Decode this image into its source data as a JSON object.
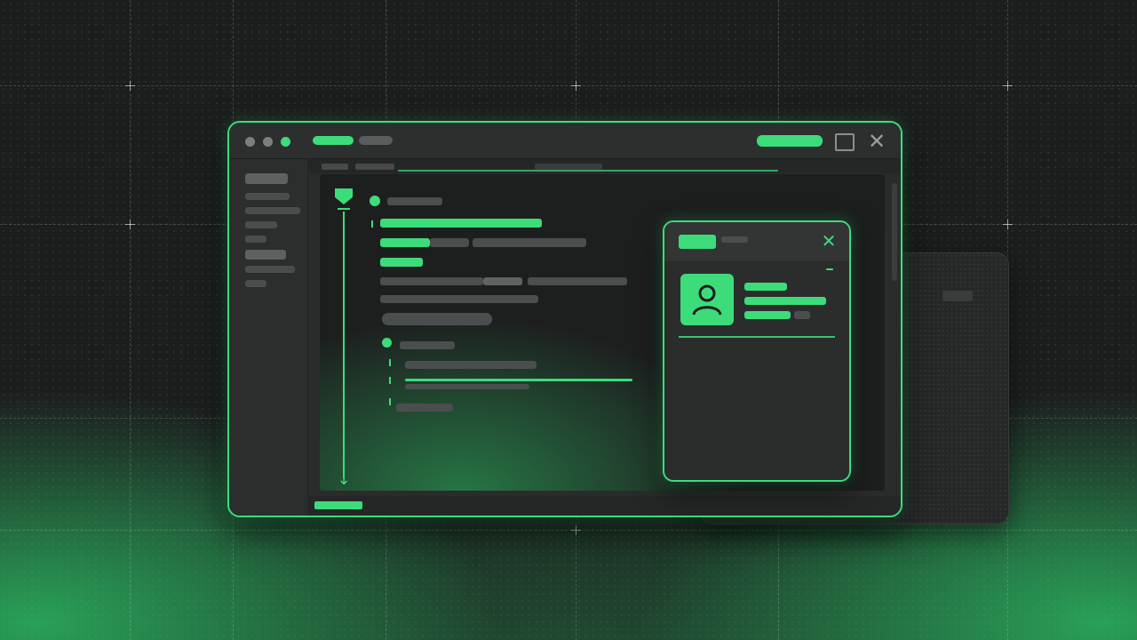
{
  "theme": {
    "accent": "#3ddc7a",
    "background": "#1c1e1e",
    "window": "#2a2c2c",
    "panel": "#1d1f1f",
    "placeholder": "#4b4e4e"
  },
  "window": {
    "controls": [
      "dot",
      "dot",
      "dot"
    ],
    "maximize_icon": "square-icon",
    "close_icon": "close-icon"
  },
  "timeline": {
    "top_icon": "shield-icon",
    "bottom_icon": "arrow-down-icon"
  },
  "popup": {
    "close_icon": "close-icon",
    "avatar_icon": "user-icon"
  }
}
